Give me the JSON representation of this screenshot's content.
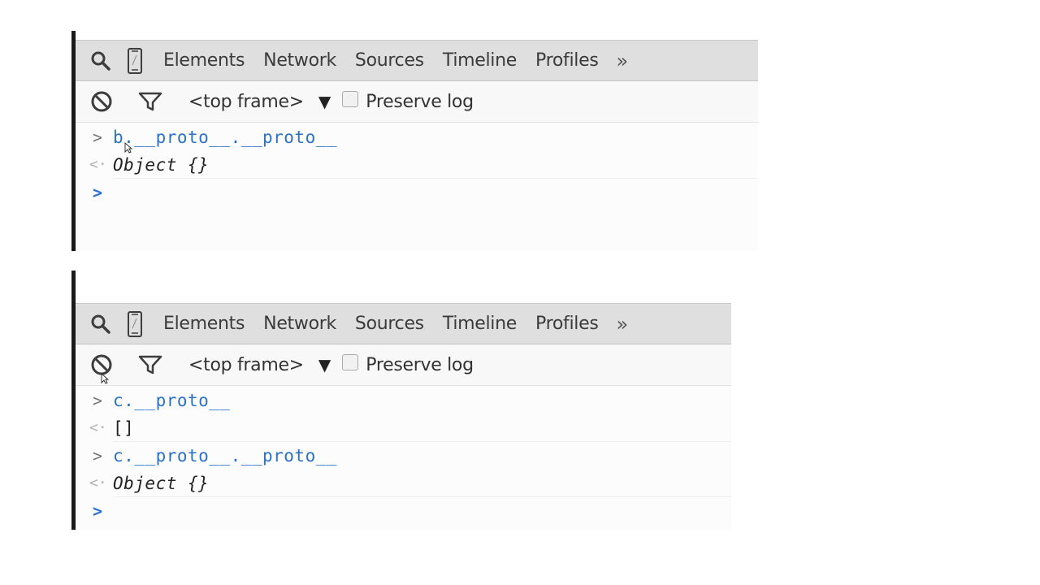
{
  "tabs": [
    "Elements",
    "Network",
    "Sources",
    "Timeline",
    "Profiles"
  ],
  "more_label": "»",
  "toolbar": {
    "frame_label": "<top frame>",
    "caret": "▼",
    "preserve_log_label": "Preserve log",
    "preserve_log_checked": false
  },
  "icons": {
    "search": "search-icon",
    "device": "device-mode-icon",
    "clear": "clear-console-icon",
    "filter": "filter-icon"
  },
  "panels": [
    {
      "console": [
        {
          "kind": "input",
          "gutter": ">",
          "text": "b.__proto__.__proto__"
        },
        {
          "kind": "output",
          "gutter": "<·",
          "text": "Object {}"
        },
        {
          "kind": "prompt",
          "gutter": ">"
        }
      ]
    },
    {
      "console": [
        {
          "kind": "input",
          "gutter": ">",
          "text": "c.__proto__"
        },
        {
          "kind": "output",
          "gutter": "<·",
          "text": "[]"
        },
        {
          "kind": "input",
          "gutter": ">",
          "text": "c.__proto__.__proto__"
        },
        {
          "kind": "output",
          "gutter": "<·",
          "text": "Object {}"
        },
        {
          "kind": "prompt",
          "gutter": ">"
        }
      ]
    }
  ]
}
